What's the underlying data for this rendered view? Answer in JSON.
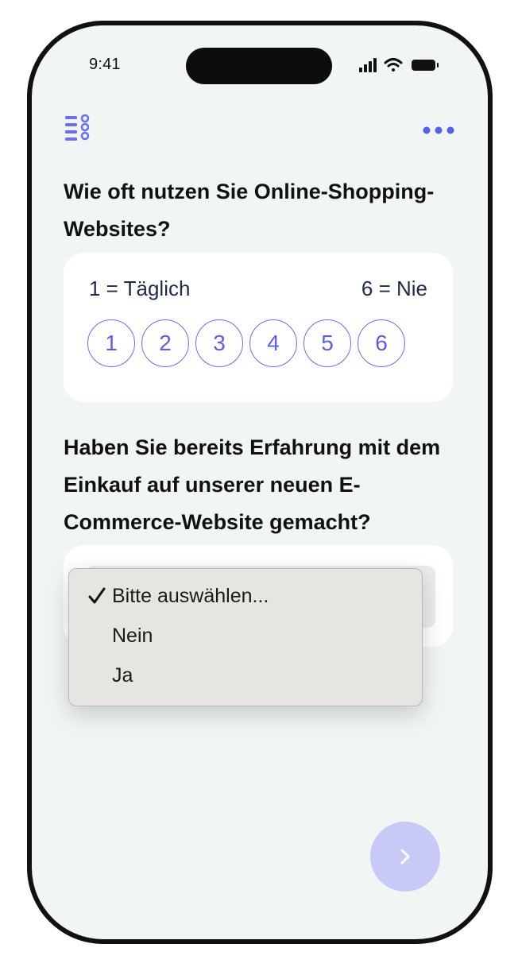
{
  "status_bar": {
    "time": "9:41"
  },
  "toolbar": {
    "list_icon": "checklist-icon",
    "more_icon": "more-dots-icon"
  },
  "question1": {
    "title": "Wie oft nutzen Sie Online-Shopping-Websites?",
    "scale_min_label": "1 = Täglich",
    "scale_max_label": "6 = Nie",
    "options": [
      "1",
      "2",
      "3",
      "4",
      "5",
      "6"
    ]
  },
  "question2": {
    "title": "Haben Sie bereits Erfahrung mit dem Einkauf auf unserer neuen E-Commerce-Website gemacht?",
    "select": {
      "options": [
        "Bitte auswählen...",
        "Nein",
        "Ja"
      ],
      "selected": "Bitte auswählen..."
    }
  },
  "colors": {
    "accent": "#5b5ee8",
    "background": "#f1f5f3",
    "next_button": "#c7c9f7"
  },
  "next_button": {
    "icon": "chevron-right-icon"
  }
}
